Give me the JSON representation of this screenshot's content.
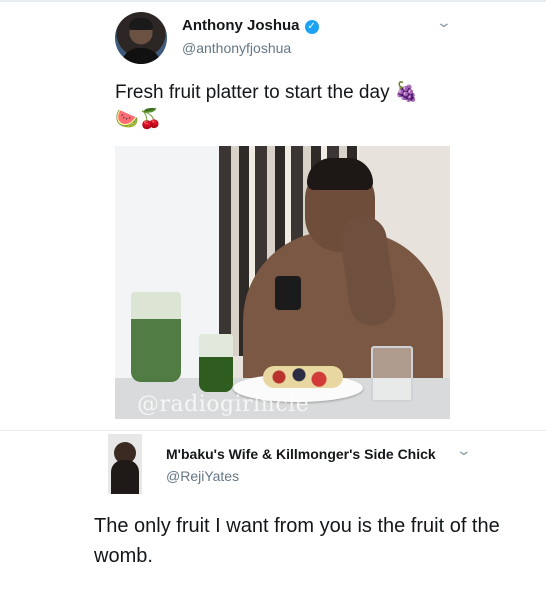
{
  "tweet1": {
    "author_name": "Anthony Joshua",
    "handle": "@anthonyfjoshua",
    "verified_icon": "verified-badge-icon",
    "text": "Fresh fruit platter to start the day",
    "emoji_inline": "🍇",
    "emoji_line": "🍉🍒",
    "photo": {
      "watermark": "@radiogirlncle"
    },
    "menu_icon": "chevron-down-icon"
  },
  "tweet2": {
    "author_name": "M'baku's Wife & Killmonger's Side Chick",
    "handle": "@RejiYates",
    "text": "The only fruit I want from you is the fruit of the womb.",
    "menu_icon": "chevron-down-icon"
  },
  "colors": {
    "verified_blue": "#1da1f2",
    "handle_gray": "#657786",
    "text_dark": "#14171a"
  }
}
